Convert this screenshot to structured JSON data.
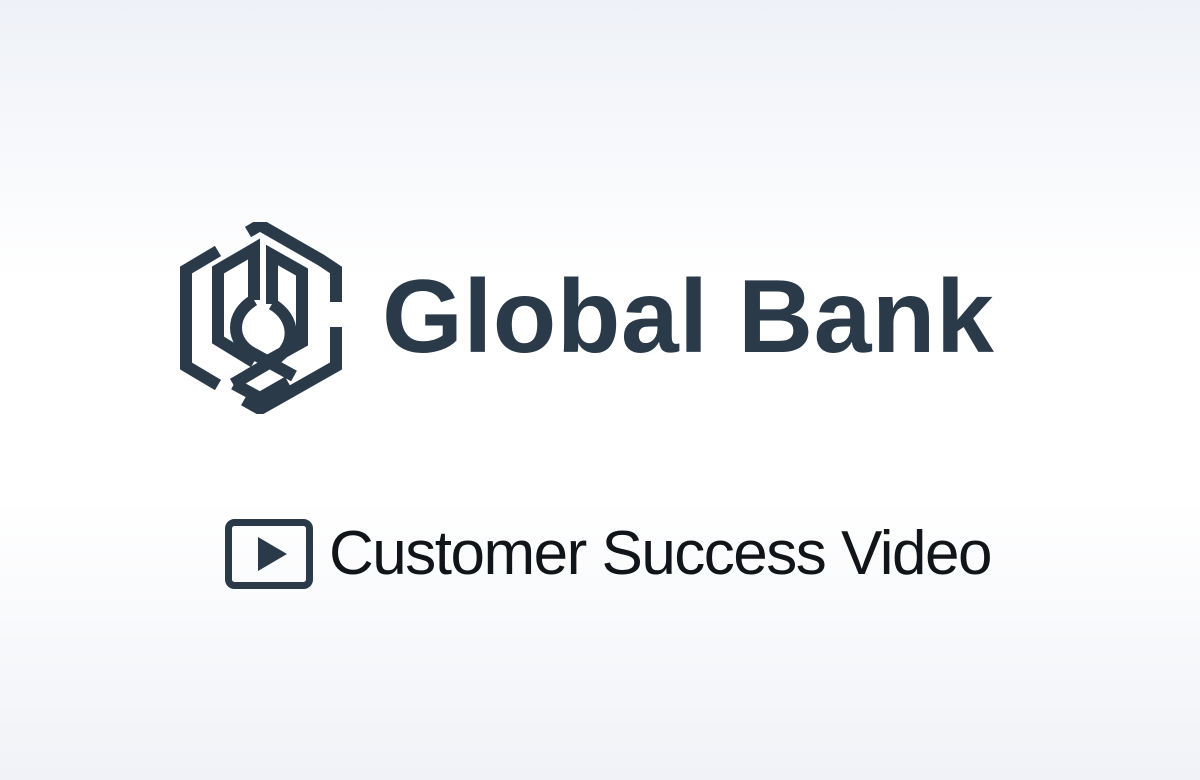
{
  "brand": {
    "name": "Global Bank",
    "logo_icon": "hexagon-knot-logo-icon",
    "color": "#2b3a48"
  },
  "video": {
    "label": "Customer Success Video",
    "icon": "video-play-icon",
    "text_color": "#111418"
  },
  "background": {
    "top": "#eef1f7",
    "middle": "#ffffff",
    "bottom": "#f0f2f7"
  }
}
